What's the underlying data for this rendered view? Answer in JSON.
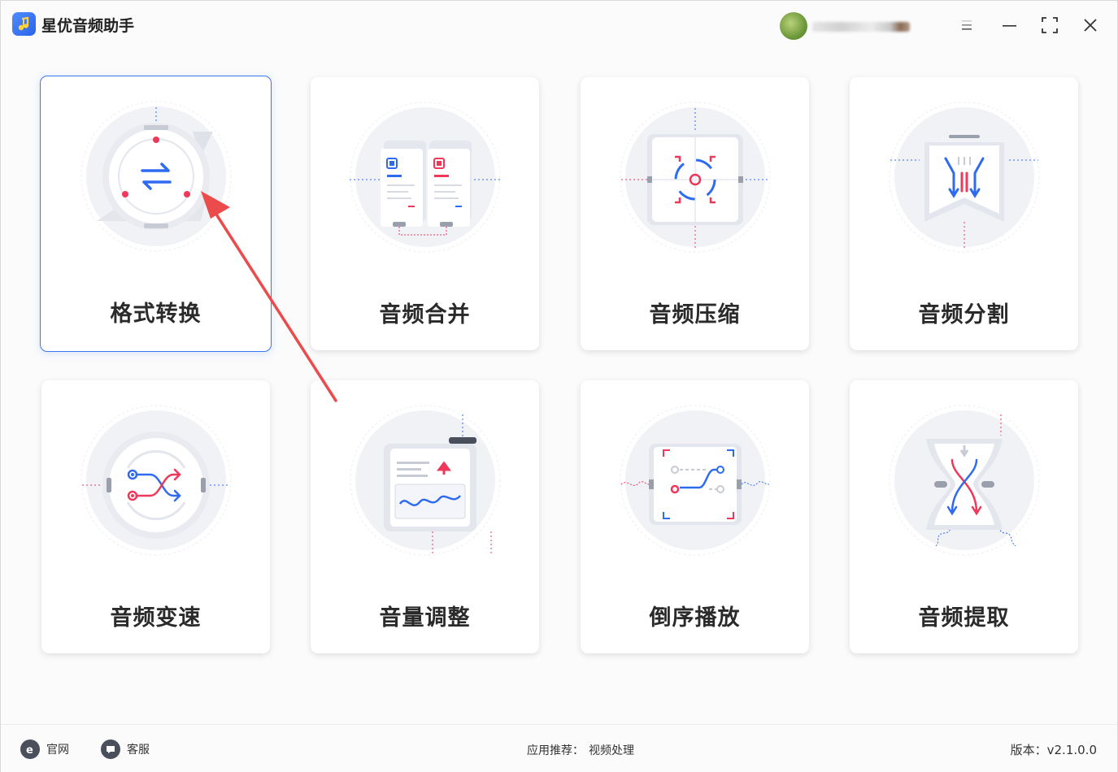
{
  "app": {
    "title": "星优音频助手"
  },
  "cards": [
    {
      "label": "格式转换",
      "icon": "format-convert-icon"
    },
    {
      "label": "音频合并",
      "icon": "audio-merge-icon"
    },
    {
      "label": "音频压缩",
      "icon": "audio-compress-icon"
    },
    {
      "label": "音频分割",
      "icon": "audio-split-icon"
    },
    {
      "label": "音频变速",
      "icon": "audio-speed-icon"
    },
    {
      "label": "音量调整",
      "icon": "volume-adjust-icon"
    },
    {
      "label": "倒序播放",
      "icon": "reverse-play-icon"
    },
    {
      "label": "音频提取",
      "icon": "audio-extract-icon"
    }
  ],
  "footer": {
    "website_label": "官网",
    "service_label": "客服",
    "recommend_prefix": "应用推荐：",
    "recommend_link": "视频处理",
    "version_text": "版本：v2.1.0.0"
  },
  "colors": {
    "accent_blue": "#2f6bf0",
    "accent_red": "#f0385a",
    "selected_border": "#3a78f0",
    "annotation_arrow": "#ec4b4b"
  }
}
